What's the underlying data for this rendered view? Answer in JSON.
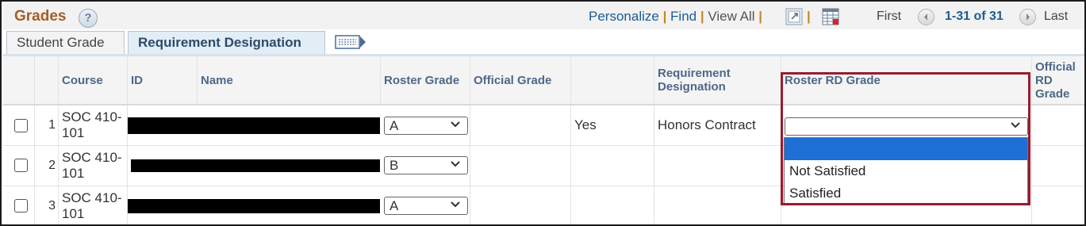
{
  "header": {
    "title": "Grades",
    "help_icon": "question-mark-icon",
    "personalize": "Personalize",
    "find": "Find",
    "view_all": "View All",
    "first": "First",
    "range": "1-31 of 31",
    "last": "Last"
  },
  "tabs": [
    {
      "label": "Student Grade"
    },
    {
      "label": "Requirement Designation"
    }
  ],
  "table": {
    "headers": {
      "course": "Course",
      "id": "ID",
      "name": "Name",
      "roster_grade": "Roster Grade",
      "official_grade": "Official Grade",
      "requirement_designation": "Requirement Designation",
      "roster_rd_grade": "Roster RD Grade",
      "official_rd_grade": "Official RD Grade"
    },
    "rows": [
      {
        "num": "1",
        "course": "SOC 410-101",
        "roster_grade": "A",
        "yes": "Yes",
        "requirement_designation": "Honors Contract",
        "roster_rd_grade": ""
      },
      {
        "num": "2",
        "course": "SOC 410-101",
        "roster_grade": "B"
      },
      {
        "num": "3",
        "course": "SOC 410-101",
        "roster_grade": "A"
      }
    ]
  },
  "dropdown": {
    "options": [
      "",
      "Not Satisfied",
      "Satisfied"
    ]
  },
  "colors": {
    "title": "#a25f2a",
    "link": "#1c5c96",
    "highlight_box": "#9a1b2f",
    "selected_option": "#1e6fd6"
  }
}
